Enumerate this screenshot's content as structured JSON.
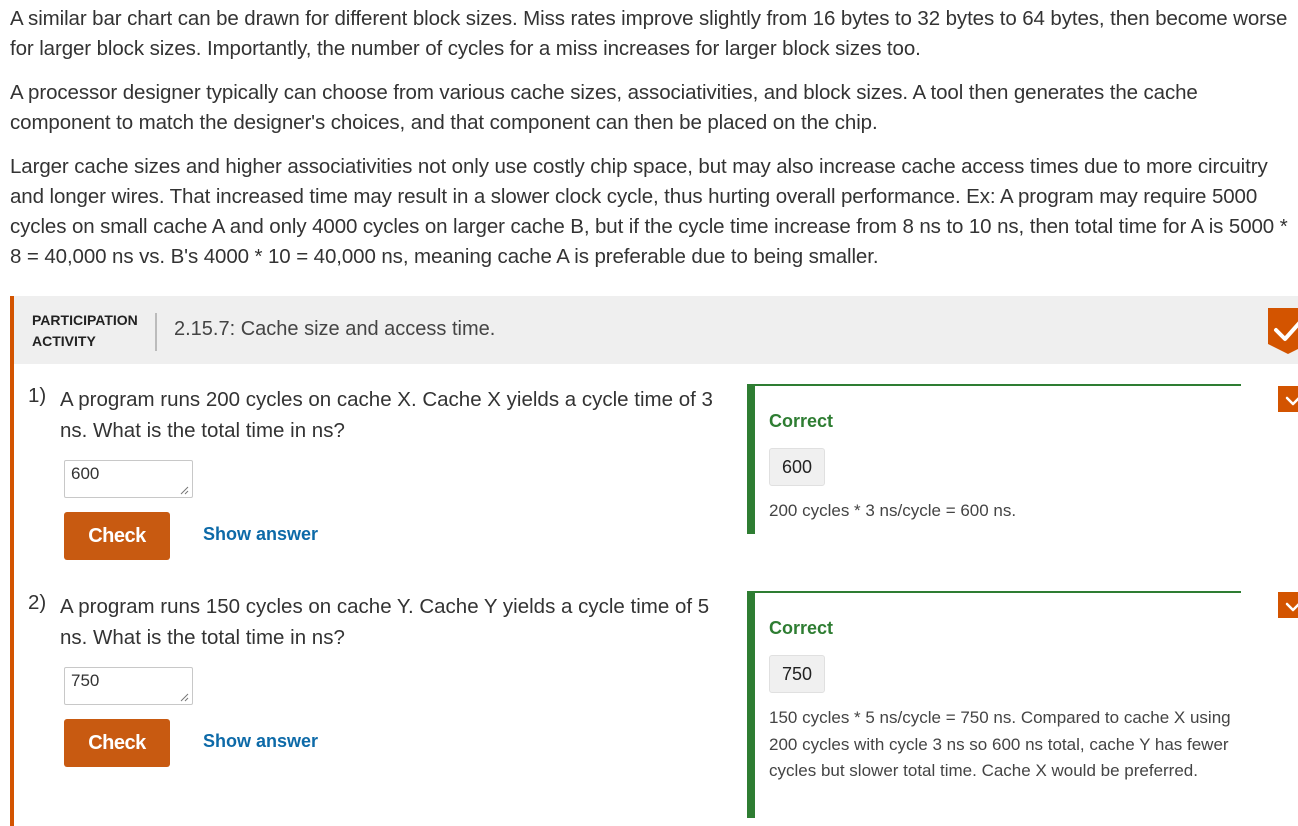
{
  "paragraphs": [
    "A similar bar chart can be drawn for different block sizes. Miss rates improve slightly from 16 bytes to 32 bytes to 64 bytes, then become worse for larger block sizes. Importantly, the number of cycles for a miss increases for larger block sizes too.",
    "A processor designer typically can choose from various cache sizes, associativities, and block sizes. A tool then generates the cache component to match the designer's choices, and that component can then be placed on the chip.",
    "Larger cache sizes and higher associativities not only use costly chip space, but may also increase cache access times due to more circuitry and longer wires. That increased time may result in a slower clock cycle, thus hurting overall performance. Ex: A program may require 5000 cycles on small cache A and only 4000 cycles on larger cache B, but if the cycle time increase from 8 ns to 10 ns, then total time for A is 5000 * 8 = 40,000 ns vs. B's 4000 * 10 = 40,000 ns, meaning cache A is preferable due to being smaller."
  ],
  "activity": {
    "label_line1": "PARTICIPATION",
    "label_line2": "ACTIVITY",
    "title": "2.15.7: Cache size and access time.",
    "accent_color": "#d35400",
    "check_color": "#d35400"
  },
  "questions": [
    {
      "number": "1)",
      "text": "A program runs 200 cycles on cache X. Cache X yields a cycle time of 3 ns. What is the total time in ns?",
      "answer_value": "600",
      "check_label": "Check",
      "show_answer_label": "Show answer",
      "feedback": {
        "status": "Correct",
        "value": "600",
        "explanation": "200 cycles * 3 ns/cycle = 600 ns."
      }
    },
    {
      "number": "2)",
      "text": "A program runs 150 cycles on cache Y. Cache Y yields a cycle time of 5 ns. What is the total time in ns?",
      "answer_value": "750",
      "check_label": "Check",
      "show_answer_label": "Show answer",
      "feedback": {
        "status": "Correct",
        "value": "750",
        "explanation": "150 cycles * 5 ns/cycle = 750 ns. Compared to cache X using 200 cycles with cycle 3 ns so 600 ns total, cache Y has fewer cycles but slower total time. Cache X would be preferred."
      }
    }
  ],
  "icons": {
    "header_complete": "checkmark-badge-icon",
    "question_complete": "checkmark-icon",
    "resize": "resize-grip-icon"
  },
  "colors": {
    "button": "#c85a11",
    "link": "#0d6aa8",
    "correct": "#2e7d32"
  }
}
